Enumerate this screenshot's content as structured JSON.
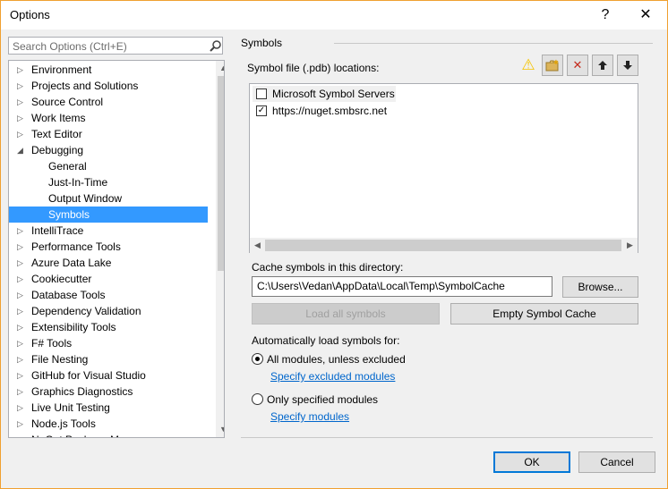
{
  "window": {
    "title": "Options",
    "help_glyph": "?",
    "close_glyph": "✕"
  },
  "search": {
    "placeholder": "Search Options (Ctrl+E)"
  },
  "tree": {
    "items": [
      {
        "label": "Environment",
        "expander": "▷"
      },
      {
        "label": "Projects and Solutions",
        "expander": "▷"
      },
      {
        "label": "Source Control",
        "expander": "▷"
      },
      {
        "label": "Work Items",
        "expander": "▷"
      },
      {
        "label": "Text Editor",
        "expander": "▷"
      },
      {
        "label": "Debugging",
        "expander": "◢"
      },
      {
        "label": "General",
        "expander": ""
      },
      {
        "label": "Just-In-Time",
        "expander": ""
      },
      {
        "label": "Output Window",
        "expander": ""
      },
      {
        "label": "Symbols",
        "expander": ""
      },
      {
        "label": "IntelliTrace",
        "expander": "▷"
      },
      {
        "label": "Performance Tools",
        "expander": "▷"
      },
      {
        "label": "Azure Data Lake",
        "expander": "▷"
      },
      {
        "label": "Cookiecutter",
        "expander": "▷"
      },
      {
        "label": "Database Tools",
        "expander": "▷"
      },
      {
        "label": "Dependency Validation",
        "expander": "▷"
      },
      {
        "label": "Extensibility Tools",
        "expander": "▷"
      },
      {
        "label": "F# Tools",
        "expander": "▷"
      },
      {
        "label": "File Nesting",
        "expander": "▷"
      },
      {
        "label": "GitHub for Visual Studio",
        "expander": "▷"
      },
      {
        "label": "Graphics Diagnostics",
        "expander": "▷"
      },
      {
        "label": "Live Unit Testing",
        "expander": "▷"
      },
      {
        "label": "Node.js Tools",
        "expander": "▷"
      },
      {
        "label": "NuGet Package Manager",
        "expander": "▷"
      }
    ],
    "selected": "Symbols"
  },
  "symbols": {
    "section_title": "Symbols",
    "locations_label": "Symbol file (.pdb) locations:",
    "locations": [
      {
        "label": "Microsoft Symbol Servers",
        "checked": false,
        "check_glyph": ""
      },
      {
        "label": "https://nuget.smbsrc.net",
        "checked": true,
        "check_glyph": "✓"
      }
    ],
    "toolbar": {
      "warning_glyph": "⚠",
      "new_glyph": "▪",
      "delete_glyph": "✕",
      "up_glyph": "🡑",
      "down_glyph": "🡓"
    },
    "cache_label": "Cache symbols in this directory:",
    "cache_path": "C:\\Users\\Vedan\\AppData\\Local\\Temp\\SymbolCache",
    "browse_label": "Browse...",
    "load_all_label": "Load all symbols",
    "empty_cache_label": "Empty Symbol Cache",
    "auto_load_label": "Automatically load symbols for:",
    "options": [
      {
        "label": "All modules, unless excluded",
        "selected": true,
        "link": "Specify excluded modules"
      },
      {
        "label": "Only specified modules",
        "selected": false,
        "link": "Specify modules"
      }
    ]
  },
  "footer": {
    "ok_label": "OK",
    "cancel_label": "Cancel"
  },
  "colors": {
    "selection": "#3399ff",
    "accent": "#0078d7",
    "link": "#0066cc",
    "warning": "#f5c400",
    "delete": "#c42b1c"
  }
}
